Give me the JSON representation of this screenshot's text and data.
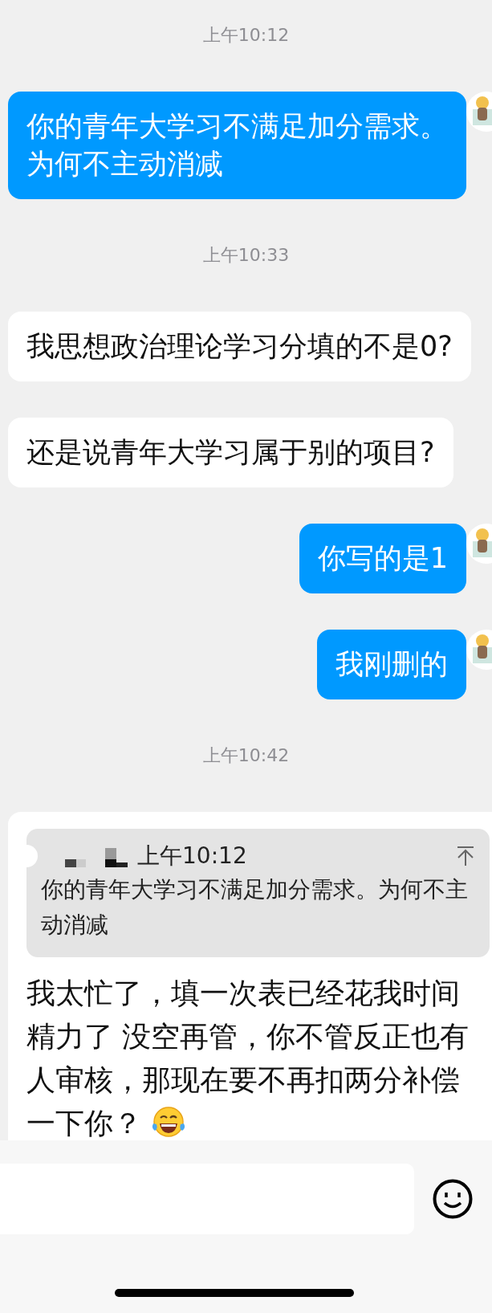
{
  "messages": [
    {
      "kind": "time",
      "text": "上午10:12"
    },
    {
      "kind": "sent",
      "lines": [
        "你的青年大学习不满足加分需求。",
        "为何不主动消减"
      ]
    },
    {
      "kind": "time",
      "text": "上午10:33"
    },
    {
      "kind": "received",
      "lines": [
        "我思想政治理论学习分填的不是0?"
      ]
    },
    {
      "kind": "received",
      "lines": [
        "还是说青年大学习属于别的项目?"
      ]
    },
    {
      "kind": "sent",
      "lines": [
        "你写的是1"
      ]
    },
    {
      "kind": "sent",
      "lines": [
        "我刚删的"
      ]
    },
    {
      "kind": "time",
      "text": "上午10:42"
    },
    {
      "kind": "reply",
      "quote": {
        "time": "上午10:12",
        "text": "你的青年大学习不满足加分需求。为何不主动消减"
      },
      "text": "我太忙了，填一次表已经花我时间精力了 没空再管，你不管反正也有人审核，那现在要不再扣两分补偿一下你？",
      "emoji": true
    }
  ],
  "composer": {
    "emoji_button": true
  }
}
